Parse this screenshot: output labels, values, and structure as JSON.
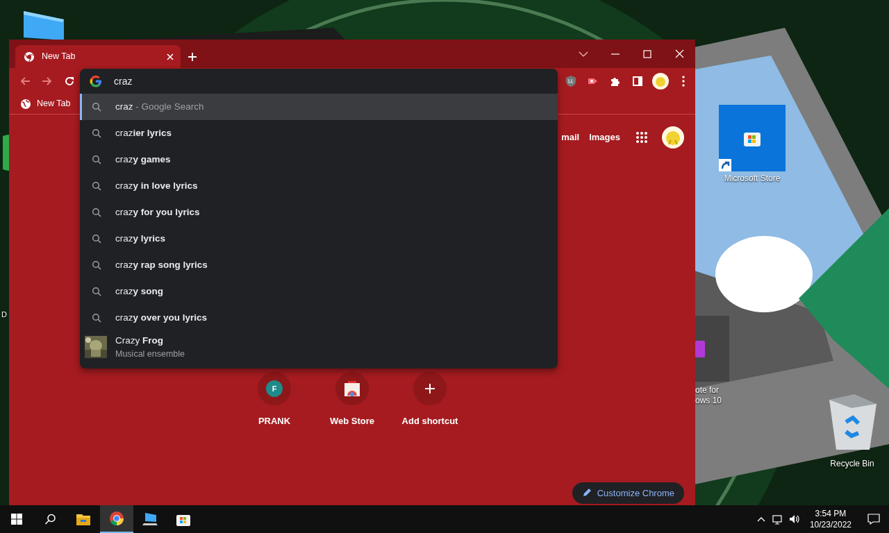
{
  "desktop": {
    "icons": [
      {
        "kind": "store",
        "lines": [
          "Microsoft Store"
        ],
        "selected": true
      },
      {
        "kind": "note",
        "lines": [
          "ote for",
          "ows 10"
        ],
        "selected": false
      },
      {
        "kind": "bin",
        "lines": [
          "Recycle Bin"
        ],
        "selected": false
      },
      {
        "kind": "cut",
        "lines": [
          "D"
        ],
        "selected": false
      }
    ]
  },
  "browser": {
    "tabs": [
      {
        "title": "New Tab",
        "selected": true
      }
    ],
    "bookmarks": [
      {
        "label": "New Tab"
      }
    ],
    "omnibox": {
      "value": "craz"
    },
    "suggestions": [
      {
        "kind": "search",
        "text": "craz",
        "suffix": "- Google Search",
        "selected": true
      },
      {
        "kind": "search",
        "text": "craz**ier lyrics**",
        "selected": false
      },
      {
        "kind": "search",
        "text": "craz**y games**",
        "selected": false
      },
      {
        "kind": "search",
        "text": "craz**y in love lyrics**",
        "selected": false
      },
      {
        "kind": "search",
        "text": "craz**y for you lyrics**",
        "selected": false
      },
      {
        "kind": "search",
        "text": "craz**y lyrics**",
        "selected": false
      },
      {
        "kind": "search",
        "text": "craz**y rap song lyrics**",
        "selected": false
      },
      {
        "kind": "search",
        "text": "craz**y song**",
        "selected": false
      },
      {
        "kind": "search",
        "text": "craz**y over you lyrics**",
        "selected": false
      },
      {
        "kind": "entity",
        "text": "Crazy **Frog**",
        "subtitle": "Musical ensemble",
        "selected": false
      }
    ],
    "header_links": [
      "mail",
      "Images"
    ],
    "shortcuts": [
      {
        "kind": "letter",
        "letter": "F",
        "label": "PRANK"
      },
      {
        "kind": "store",
        "label": "Web Store"
      },
      {
        "kind": "add",
        "label": "Add shortcut"
      }
    ],
    "customize_button": "Customize Chrome"
  },
  "taskbar": {
    "apps": [
      {
        "kind": "start",
        "selected": false
      },
      {
        "kind": "search",
        "selected": false
      },
      {
        "kind": "folder",
        "selected": false
      },
      {
        "kind": "browser",
        "selected": true
      },
      {
        "kind": "pc",
        "selected": false
      },
      {
        "kind": "store",
        "selected": false
      }
    ],
    "clock": {
      "time": "3:54 PM",
      "date": "10/23/2022"
    }
  }
}
